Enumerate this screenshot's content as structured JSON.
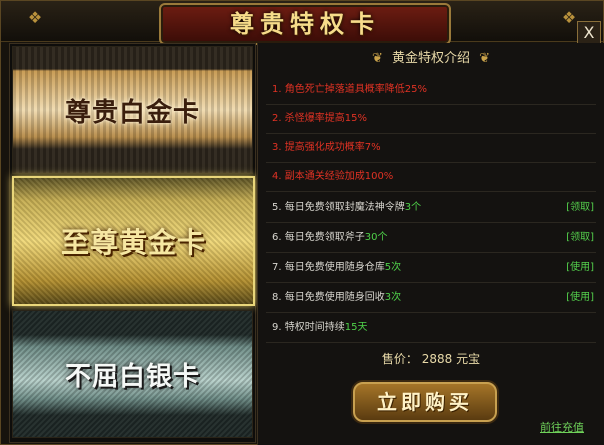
{
  "window": {
    "title": "尊贵特权卡",
    "close_label": "X"
  },
  "cards": [
    {
      "id": "platinum",
      "label": "尊贵白金卡"
    },
    {
      "id": "gold",
      "label": "至尊黄金卡",
      "selected": true
    },
    {
      "id": "silver",
      "label": "不屈白银卡"
    }
  ],
  "benefits": {
    "header": "黄金特权介绍",
    "rows": [
      {
        "text": "1. 角色死亡掉落道具概率降低25%",
        "style": "red"
      },
      {
        "text": "2. 杀怪爆率提高15%",
        "style": "red"
      },
      {
        "text": "3. 提高强化成功概率7%",
        "style": "red"
      },
      {
        "text": "4. 副本通关经验加成100%",
        "style": "red"
      },
      {
        "pre": "5. 每日免费领取封魔法神令牌",
        "hl": "3个",
        "post": "",
        "action": "[领取]"
      },
      {
        "pre": "6. 每日免费领取斧子",
        "hl": "30个",
        "post": "",
        "action": "[领取]"
      },
      {
        "pre": "7. 每日免费使用随身仓库",
        "hl": "5次",
        "post": "",
        "action": "[使用]"
      },
      {
        "pre": "8. 每日免费使用随身回收",
        "hl": "3次",
        "post": "",
        "action": "[使用]"
      },
      {
        "pre": "9. 特权时间持续",
        "hl": "15天",
        "post": ""
      }
    ]
  },
  "purchase": {
    "price_label": "售价：",
    "price_value": "2888",
    "price_unit": "元宝",
    "buy_label": "立即购买",
    "recharge_label": "前往充值"
  },
  "colors": {
    "accent_gold": "#c8a050",
    "highlight_green": "#4fd24a",
    "warning_red": "#e03224"
  }
}
